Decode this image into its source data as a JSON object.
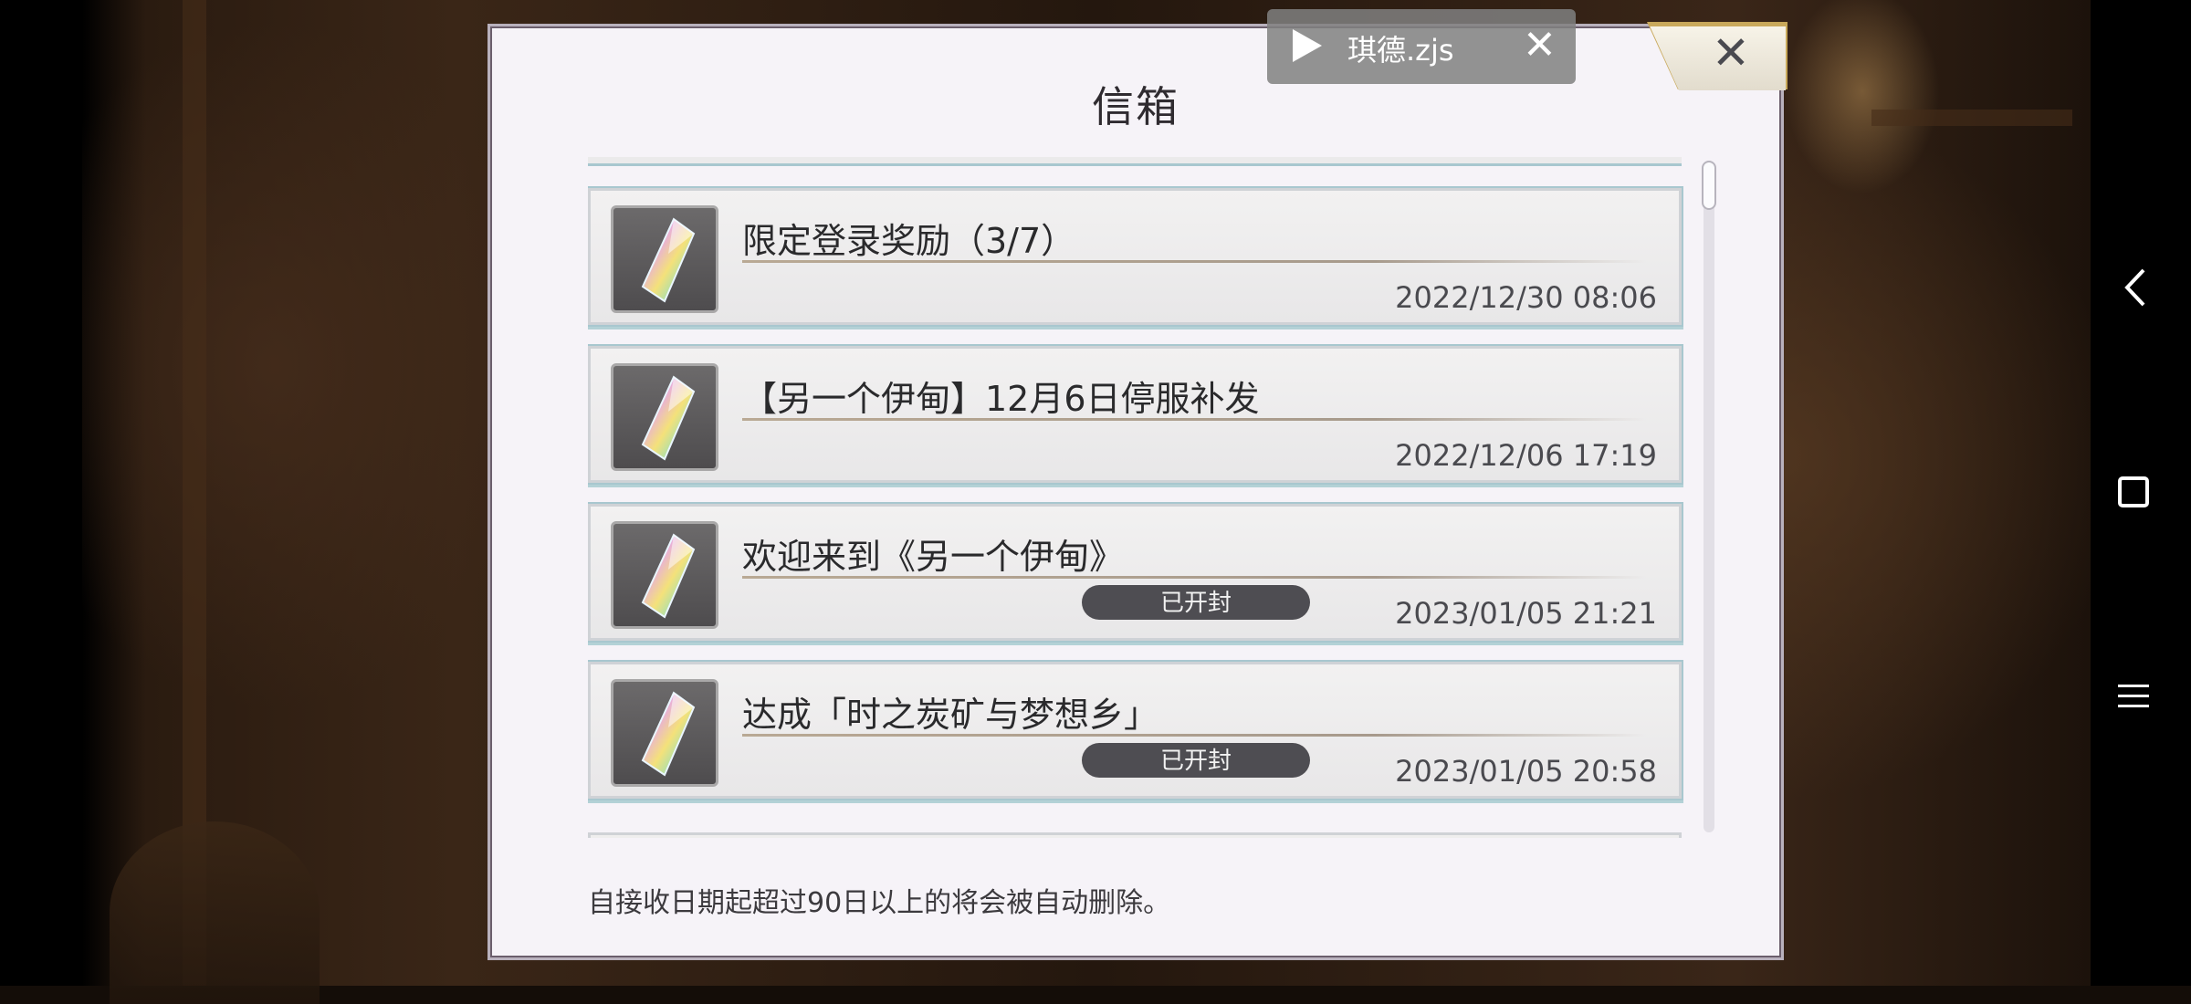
{
  "script_overlay": {
    "name": "琪德.zjs"
  },
  "dialog": {
    "title": "信箱",
    "footer_note": "自接收日期起超过90日以上的将会被自动删除。"
  },
  "mail_items": [
    {
      "title": "限定登录奖励（3/7）",
      "date": "2022/12/30 08:06",
      "status": ""
    },
    {
      "title": "【另一个伊甸】12月6日停服补发",
      "date": "2022/12/06 17:19",
      "status": ""
    },
    {
      "title": "欢迎来到《另一个伊甸》",
      "date": "2023/01/05 21:21",
      "status": "已开封"
    },
    {
      "title": "达成「时之炭矿与梦想乡」",
      "date": "2023/01/05 20:58",
      "status": "已开封"
    }
  ],
  "icons": {
    "mail_icon": "rainbow-crystal-icon",
    "close": "close-icon",
    "nav_back": "back-icon",
    "nav_home": "home-icon",
    "nav_menu": "menu-icon",
    "play": "play-icon"
  }
}
